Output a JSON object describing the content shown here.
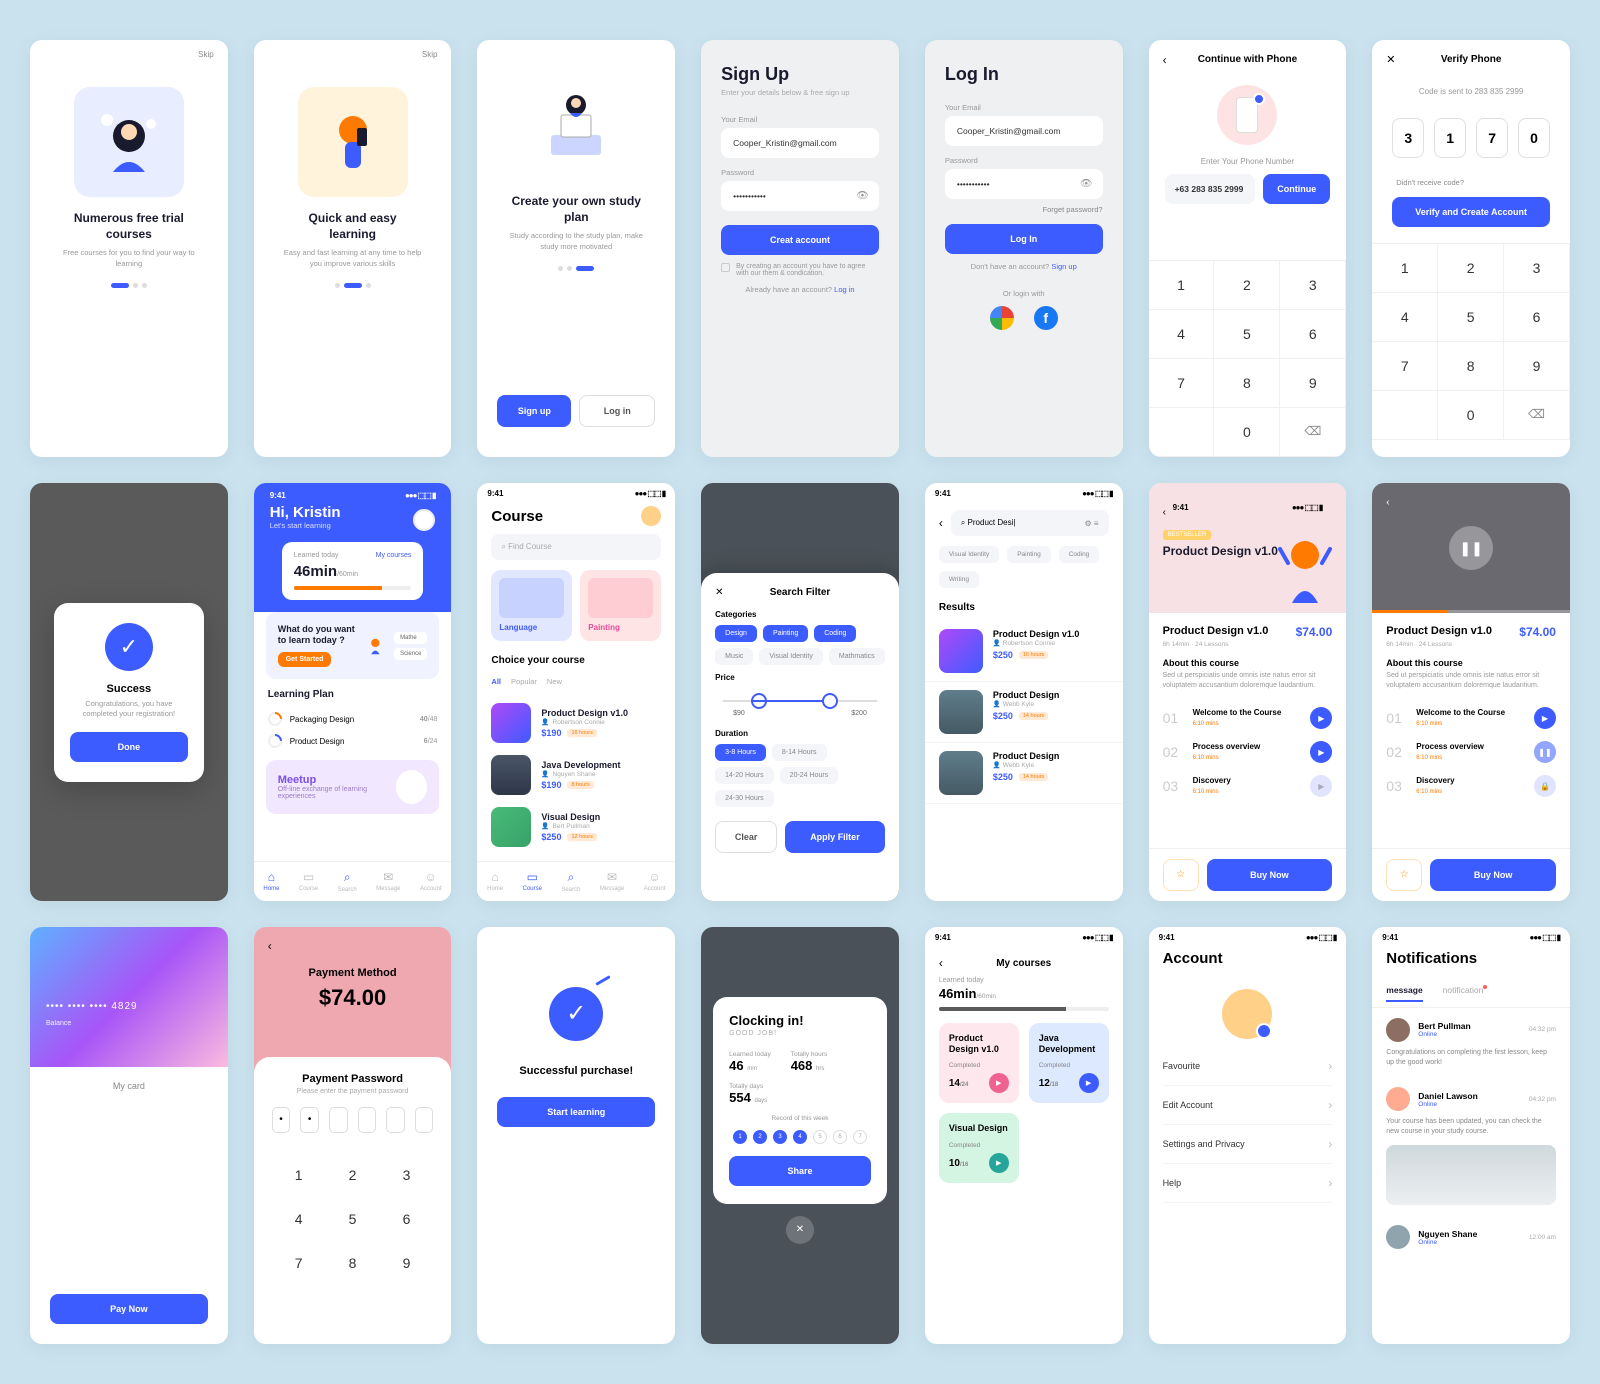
{
  "common": {
    "skip": "Skip",
    "time": "9:41",
    "signals": "●●● ⬚⬚ ▮"
  },
  "onboard": [
    {
      "title": "Numerous free trial courses",
      "sub": "Free courses for you to find your way to learning"
    },
    {
      "title": "Quick and easy learning",
      "sub": "Easy and fast learning at any time to help you improve various skills"
    },
    {
      "title": "Create your own study plan",
      "sub": "Study according to the study plan, make study more motivated",
      "btn1": "Sign up",
      "btn2": "Log in"
    }
  ],
  "signup": {
    "title": "Sign Up",
    "sub": "Enter your details below & free sign up",
    "email_label": "Your Email",
    "email": "Cooper_Kristin@gmail.com",
    "pass_label": "Password",
    "pass": "•••••••••••",
    "btn": "Creat account",
    "check": "By creating an account you have to agree with our them & condication.",
    "already": "Already have an account? ",
    "login": "Log in"
  },
  "login": {
    "title": "Log In",
    "email_label": "Your Email",
    "email": "Cooper_Kristin@gmail.com",
    "pass_label": "Password",
    "pass": "•••••••••••",
    "forgot": "Forget password?",
    "btn": "Log In",
    "no_acc": "Don't have an account? ",
    "signup": "Sign up",
    "or": "Or login with"
  },
  "phone": {
    "title": "Continue with Phone",
    "help": "Enter Your Phone Number",
    "number": "+63 283 835 2999",
    "btn": "Continue",
    "keys": [
      "1",
      "2",
      "3",
      "4",
      "5",
      "6",
      "7",
      "8",
      "9",
      "",
      "0",
      "⌫"
    ]
  },
  "verify": {
    "title": "Verify Phone",
    "sent": "Code is sent to 283 835 2999",
    "digits": [
      "3",
      "1",
      "7",
      "0"
    ],
    "resend": "Didn't receive code?",
    "btn": "Verify and Create Account",
    "keys": [
      "1",
      "2",
      "3",
      "4",
      "5",
      "6",
      "7",
      "8",
      "9",
      "",
      "0",
      "⌫"
    ]
  },
  "success_modal": {
    "title": "Success",
    "msg": "Congratulations, you have completed your registration!",
    "btn": "Done"
  },
  "home": {
    "hi": "Hi, Kristin",
    "sub": "Let's start learning",
    "stat_label": "Learned today",
    "stat_link": "My courses",
    "time": "46min",
    "max": "/60min",
    "learn_q": "What do you want to learn today ?",
    "get_started": "Get Started",
    "cat1": "Mathe",
    "cat2": "Science",
    "plan_h": "Learning Plan",
    "plans": [
      {
        "name": "Packaging Design",
        "done": "40",
        "total": "/48"
      },
      {
        "name": "Product Design",
        "done": "6",
        "total": "/24"
      }
    ],
    "meetup": "Meetup",
    "meetup_sub": "Off-line exchange of learning experiences",
    "tabs": [
      "Home",
      "Course",
      "Search",
      "Message",
      "Account"
    ]
  },
  "course": {
    "title": "Course",
    "search": "Find Course",
    "cat1": "Language",
    "cat2": "Painting",
    "choice": "Choice your course",
    "pills": [
      "All",
      "Popular",
      "New"
    ],
    "items": [
      {
        "name": "Product Design v1.0",
        "author": "Robertson Connie",
        "price": "$190",
        "tag": "16 hours"
      },
      {
        "name": "Java Development",
        "author": "Nguyen Shane",
        "price": "$190",
        "tag": "8 hours"
      },
      {
        "name": "Visual Design",
        "author": "Bert Pullman",
        "price": "$250",
        "tag": "12 hours"
      }
    ]
  },
  "filter": {
    "title": "Search Filter",
    "cat_h": "Categories",
    "cats": [
      "Design",
      "Painting",
      "Coding",
      "Music",
      "Visual Identity",
      "Mathmatics"
    ],
    "price_h": "Price",
    "p1": "$90",
    "p2": "$200",
    "dur_h": "Duration",
    "durs": [
      "3-8 Hours",
      "8-14 Hours",
      "14-20 Hours",
      "20-24 Hours",
      "24-30 Hours"
    ],
    "clear": "Clear",
    "apply": "Apply Filter"
  },
  "results": {
    "query": "Product Desi",
    "tags": [
      "Visual Identity",
      "Painting",
      "Coding",
      "Writing"
    ],
    "heading": "Results",
    "items": [
      {
        "name": "Product Design v1.0",
        "author": "Robertson Connie",
        "price": "$250",
        "tag": "16 hours"
      },
      {
        "name": "Product Design",
        "author": "Webb Kyle",
        "price": "$250",
        "tag": "14 hours"
      },
      {
        "name": "Product Design",
        "author": "Webb Kyle",
        "price": "$250",
        "tag": "14 hours"
      }
    ]
  },
  "product": {
    "best": "BESTSELLER",
    "hero": "Product Design v1.0",
    "title": "Product Design v1.0",
    "price": "$74.00",
    "meta": "6h 14min · 24 Lessons",
    "about_h": "About this course",
    "about": "Sed ut perspiciatis unde omnis iste natus error sit voluptatem accusantium doloremque laudantium.",
    "lessons": [
      {
        "n": "01",
        "t": "Welcome to the Course",
        "d": "6:10  mins",
        "play": true
      },
      {
        "n": "02",
        "t": "Process overview",
        "d": "6:10  mins",
        "play": true
      },
      {
        "n": "03",
        "t": "Discovery",
        "d": "6:10  mins",
        "lock": true
      }
    ],
    "buy": "Buy Now",
    "star": "☆"
  },
  "card_pay": {
    "num": "•••• •••• ••••  4829",
    "bal": "Balance",
    "section": "My card",
    "btn": "Pay Now"
  },
  "pay_pass": {
    "method": "Payment Method",
    "amount": "$74.00",
    "title": "Payment Password",
    "sub": "Please enter the payment password",
    "pins": [
      "•",
      "•",
      "",
      "",
      "",
      ""
    ],
    "keys": [
      "1",
      "2",
      "3",
      "4",
      "5",
      "6",
      "7",
      "8",
      "9"
    ]
  },
  "purchase_ok": {
    "title": "Successful purchase!",
    "btn": "Start learning"
  },
  "clock": {
    "title": "Clocking in!",
    "good": "GOOD JOB!",
    "stats": [
      {
        "lab": "Learned today",
        "val": "46",
        "unit": "min"
      },
      {
        "lab": "Totally hours",
        "val": "468",
        "unit": "hrs"
      },
      {
        "lab": "Totally days",
        "val": "554",
        "unit": "days"
      }
    ],
    "record": "Record of this week",
    "days": [
      "1",
      "2",
      "3",
      "4",
      "5",
      "6",
      "7"
    ],
    "btn": "Share",
    "close": "✕"
  },
  "mycourses": {
    "title": "My courses",
    "learned": "Learned today",
    "val": "46min",
    "max": "/60min",
    "cards": [
      {
        "name": "Product Design v1.0",
        "stat": "Completed",
        "done": "14",
        "total": "/24",
        "cls": "pink"
      },
      {
        "name": "Java Development",
        "stat": "Completed",
        "done": "12",
        "total": "/18",
        "cls": "blue"
      },
      {
        "name": "Visual Design",
        "stat": "Completed",
        "done": "10",
        "total": "/16",
        "cls": "green"
      }
    ]
  },
  "account": {
    "title": "Account",
    "items": [
      "Favourite",
      "Edit Account",
      "Settings and Privacy",
      "Help"
    ]
  },
  "notifications": {
    "title": "Notifications",
    "tabs": [
      "message",
      "notification"
    ],
    "items": [
      {
        "name": "Bert Pullman",
        "status": "Online",
        "time": "04:32 pm",
        "msg": "Congratulations on completing the first lesson, keep up the good work!"
      },
      {
        "name": "Daniel Lawson",
        "status": "Online",
        "time": "04:32 pm",
        "msg": "Your course has been updated, you can check the new course in your study course.",
        "img": true
      },
      {
        "name": "Nguyen Shane",
        "status": "Online",
        "time": "12:00 am"
      }
    ]
  }
}
